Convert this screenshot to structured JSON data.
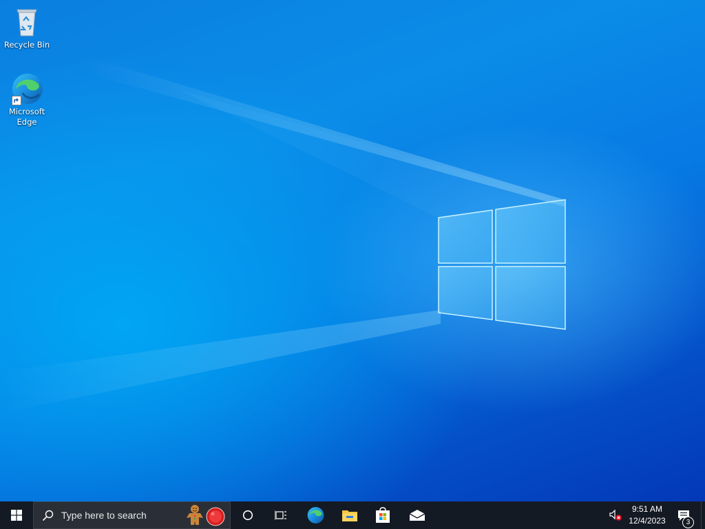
{
  "desktop": {
    "icons": [
      {
        "label": "Recycle Bin",
        "icon": "recycle-bin-icon"
      },
      {
        "label": "Microsoft\nEdge",
        "icon": "edge-icon"
      }
    ]
  },
  "taskbar": {
    "start_icon": "windows-logo-icon",
    "search": {
      "placeholder": "Type here to search",
      "icon": "search-icon"
    },
    "search_highlights": [
      "gingerbread-icon",
      "red-ornament-icon"
    ],
    "cortana_icon": "cortana-circle-icon",
    "task_view_icon": "task-view-icon",
    "pinned": [
      "edge-icon",
      "file-explorer-icon",
      "microsoft-store-icon",
      "mail-icon"
    ],
    "tray": {
      "volume_icon": "volume-muted-icon",
      "time": "9:51 AM",
      "date": "12/4/2023",
      "notifications_icon": "action-center-icon",
      "notification_count": "3"
    }
  },
  "colors": {
    "taskbar_bg": "#141a24",
    "desktop_accent": "#0a7fe0",
    "edge_blue": "#0c59a4",
    "edge_green": "#4fd06c"
  }
}
